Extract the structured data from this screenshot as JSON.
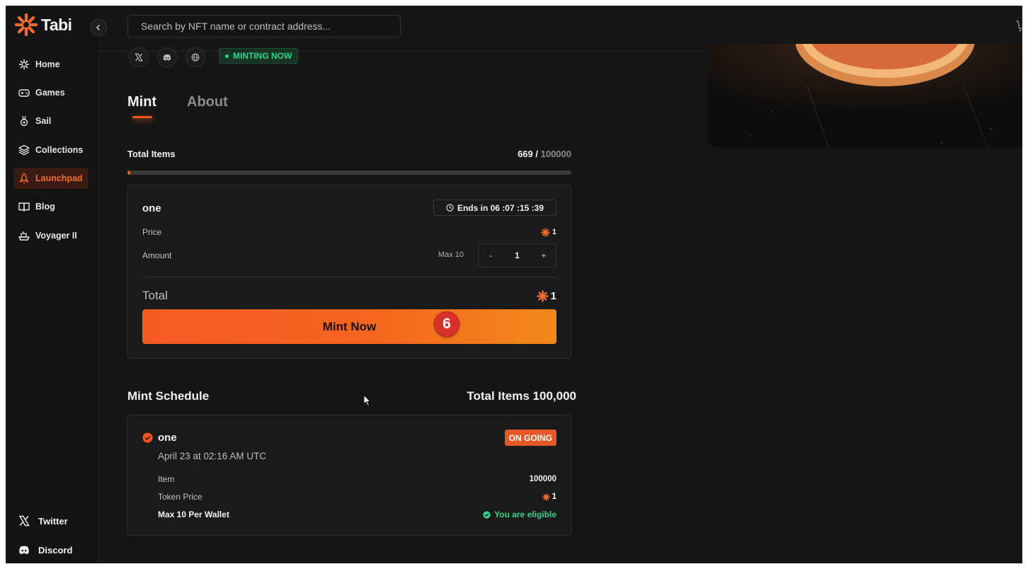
{
  "app": {
    "name": "Tabi"
  },
  "sidebar": {
    "items": [
      {
        "label": "Home",
        "icon": "sparkle-icon"
      },
      {
        "label": "Games",
        "icon": "gamepad-icon"
      },
      {
        "label": "Sail",
        "icon": "medal-icon"
      },
      {
        "label": "Collections",
        "icon": "layers-icon"
      },
      {
        "label": "Launchpad",
        "icon": "rocket-icon",
        "active": true
      },
      {
        "label": "Blog",
        "icon": "book-icon"
      },
      {
        "label": "Voyager II",
        "icon": "ship-icon"
      }
    ],
    "footer": [
      {
        "label": "Twitter",
        "icon": "x-logo-icon"
      },
      {
        "label": "Discord",
        "icon": "discord-icon"
      }
    ]
  },
  "search": {
    "placeholder": "Search by NFT name or contract address..."
  },
  "collection": {
    "status_label": "MINTING NOW"
  },
  "tabs": [
    {
      "label": "Mint",
      "active": true
    },
    {
      "label": "About",
      "active": false
    }
  ],
  "totals": {
    "label": "Total Items",
    "minted": "669",
    "separator": " / ",
    "supply": "100000",
    "progress_fraction": 0.00669
  },
  "mint_card": {
    "phase_name": "one",
    "ends_label": "Ends in 06 :07 :15 :39",
    "price_label": "Price",
    "price_value": "1",
    "amount_label": "Amount",
    "max_label": "Max 10",
    "quantity": "1",
    "decrement": "-",
    "increment": "+",
    "total_label": "Total",
    "total_value": "1",
    "mint_button": "Mint Now",
    "step_marker": "6"
  },
  "schedule": {
    "title": "Mint Schedule",
    "total_label": "Total Items 100,000",
    "phase": {
      "name": "one",
      "status": "ON GOING",
      "date": "April 23 at 02:16 AM UTC",
      "item_label": "Item",
      "item_value": "100000",
      "token_price_label": "Token Price",
      "token_price_value": "1",
      "wallet_limit": "Max 10 Per Wallet",
      "eligibility": "You are eligible"
    }
  },
  "colors": {
    "accent": "#f0561e",
    "success": "#2fd38a",
    "background": "#161616"
  }
}
